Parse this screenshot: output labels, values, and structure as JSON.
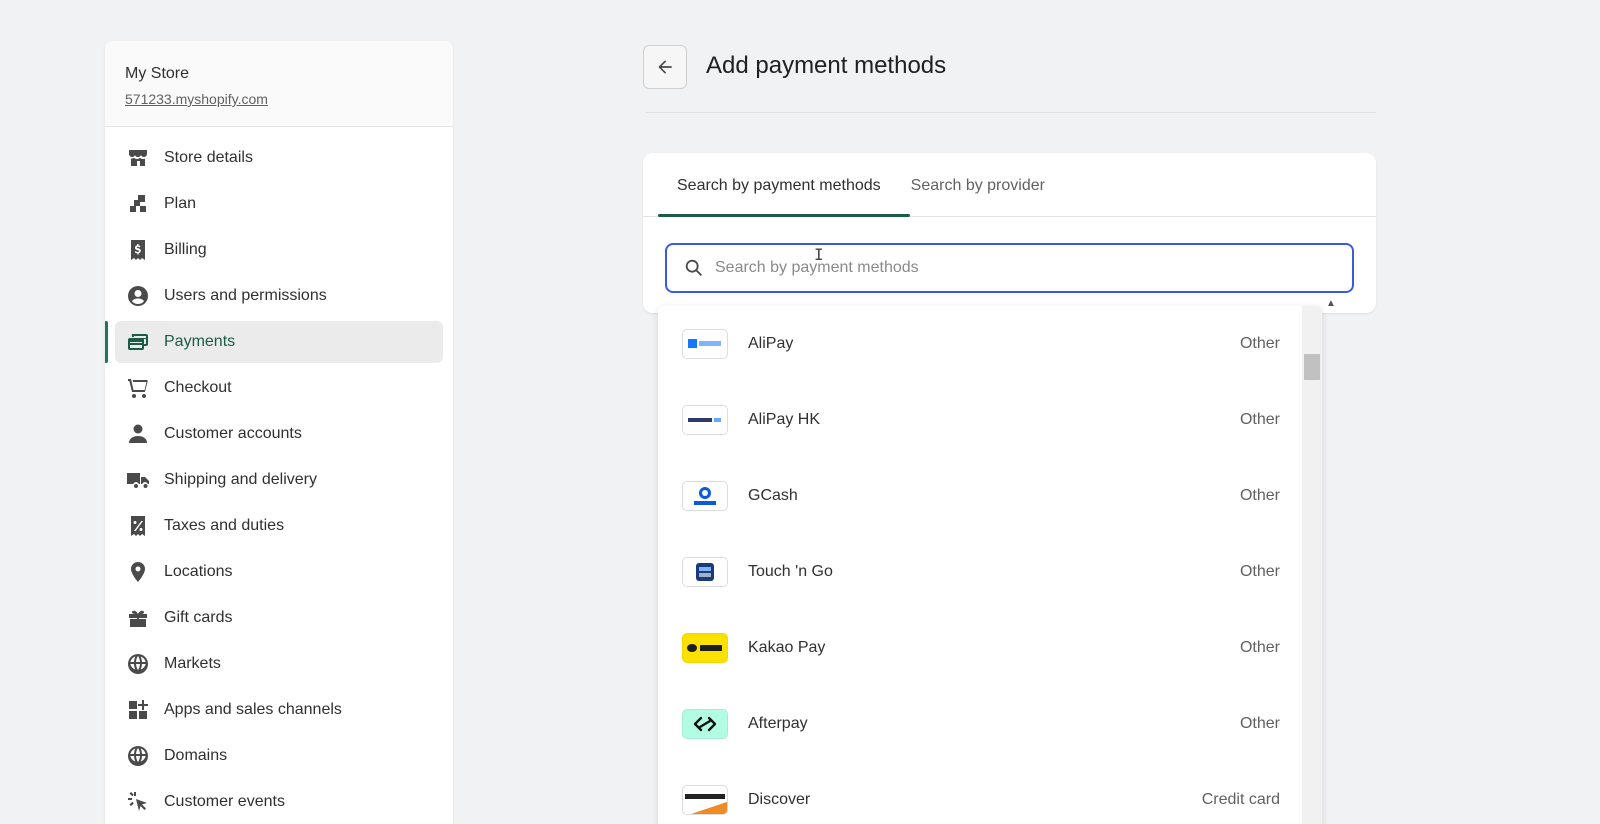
{
  "store": {
    "name": "My Store",
    "domain": "571233.myshopify.com"
  },
  "sidebar": {
    "items": [
      {
        "label": "Store details",
        "icon": "store-icon"
      },
      {
        "label": "Plan",
        "icon": "plan-icon"
      },
      {
        "label": "Billing",
        "icon": "billing-icon"
      },
      {
        "label": "Users and permissions",
        "icon": "user-circle-icon"
      },
      {
        "label": "Payments",
        "icon": "payments-icon",
        "active": true
      },
      {
        "label": "Checkout",
        "icon": "cart-icon"
      },
      {
        "label": "Customer accounts",
        "icon": "person-icon"
      },
      {
        "label": "Shipping and delivery",
        "icon": "truck-icon"
      },
      {
        "label": "Taxes and duties",
        "icon": "tax-icon"
      },
      {
        "label": "Locations",
        "icon": "location-pin-icon"
      },
      {
        "label": "Gift cards",
        "icon": "gift-icon"
      },
      {
        "label": "Markets",
        "icon": "globe-icon"
      },
      {
        "label": "Apps and sales channels",
        "icon": "apps-icon"
      },
      {
        "label": "Domains",
        "icon": "domain-globe-icon"
      },
      {
        "label": "Customer events",
        "icon": "cursor-click-icon"
      }
    ]
  },
  "main": {
    "title": "Add payment methods",
    "tabs": [
      {
        "label": "Search by payment methods",
        "selected": true
      },
      {
        "label": "Search by provider",
        "selected": false
      }
    ],
    "search": {
      "placeholder": "Search by payment methods",
      "value": ""
    }
  },
  "options": [
    {
      "name": "AliPay",
      "type": "Other",
      "logo": "alipay-logo"
    },
    {
      "name": "AliPay HK",
      "type": "Other",
      "logo": "alipay-hk-logo"
    },
    {
      "name": "GCash",
      "type": "Other",
      "logo": "gcash-logo"
    },
    {
      "name": "Touch 'n Go",
      "type": "Other",
      "logo": "touch-n-go-logo"
    },
    {
      "name": "Kakao Pay",
      "type": "Other",
      "logo": "kakao-pay-logo"
    },
    {
      "name": "Afterpay",
      "type": "Other",
      "logo": "afterpay-logo"
    },
    {
      "name": "Discover",
      "type": "Credit card",
      "logo": "discover-logo"
    }
  ],
  "colors": {
    "accent_green": "#1a5c45",
    "focus_blue": "#3b5bdb",
    "background": "#f1f2f4"
  }
}
